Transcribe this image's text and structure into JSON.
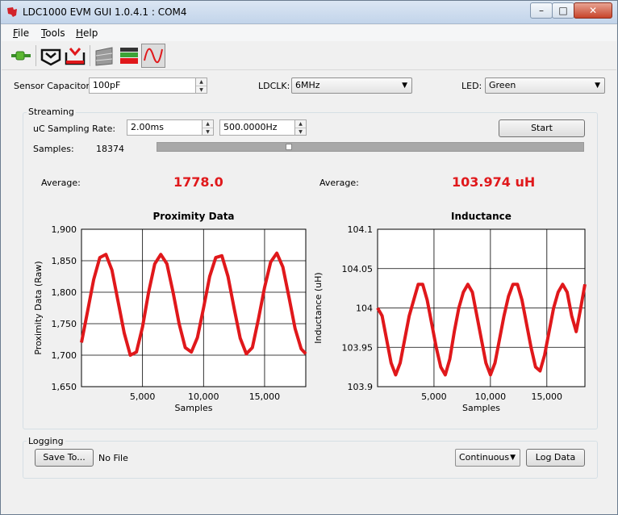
{
  "window": {
    "title": "LDC1000 EVM GUI 1.0.4.1 : COM4",
    "min_glyph": "–",
    "max_glyph": "□",
    "close_glyph": "✕"
  },
  "menu": [
    {
      "first": "F",
      "rest": "ile"
    },
    {
      "first": "T",
      "rest": "ools"
    },
    {
      "first": "H",
      "rest": "elp"
    }
  ],
  "toolbar": {
    "icons": [
      "connect-plug-icon",
      "read-register-icon",
      "write-register-icon",
      "config-icon",
      "threshold-icon",
      "graph-icon"
    ],
    "accent": "#e0181b"
  },
  "settings": {
    "sensor_cap_label": "Sensor Capacitor:",
    "sensor_cap_value": "100pF",
    "ldclk_label": "LDCLK:",
    "ldclk_value": "6MHz",
    "led_label": "LED:",
    "led_value": "Green"
  },
  "streaming": {
    "title": "Streaming",
    "rate_label": "uC Sampling Rate:",
    "rate_ms": "2.00ms",
    "rate_hz": "500.0000Hz",
    "start_label": "Start",
    "samples_label": "Samples:",
    "samples_value": "18374",
    "avg_label_1": "Average:",
    "avg_value_1": "1778.0",
    "avg_label_2": "Average:",
    "avg_value_2": "103.974 uH"
  },
  "logging": {
    "title": "Logging",
    "save_label": "Save To...",
    "file_label": "No File",
    "mode_value": "Continuous",
    "log_label": "Log Data"
  },
  "chart_data": [
    {
      "type": "line",
      "title": "Proximity Data",
      "xlabel": "Samples",
      "ylabel": "Proximity Data (Raw)",
      "xlim": [
        0,
        18374
      ],
      "ylim": [
        1650,
        1900
      ],
      "xticks": [
        5000,
        10000,
        15000
      ],
      "xtick_labels": [
        "5,000",
        "10,000",
        "15,000"
      ],
      "yticks": [
        1650,
        1700,
        1750,
        1800,
        1850,
        1900
      ],
      "ytick_labels": [
        "1,650",
        "1,700",
        "1,750",
        "1,800",
        "1,850",
        "1,900"
      ],
      "grid": true,
      "color": "#e0181b",
      "series": [
        {
          "x": [
            0,
            500,
            1000,
            1500,
            2000,
            2500,
            3000,
            3500,
            4000,
            4500,
            5000,
            5500,
            6000,
            6500,
            7000,
            7500,
            8000,
            8500,
            9000,
            9500,
            10000,
            10500,
            11000,
            11500,
            12000,
            12500,
            13000,
            13500,
            14000,
            14500,
            15000,
            15500,
            16000,
            16500,
            17000,
            17500,
            18000,
            18374
          ],
          "y": [
            1720,
            1770,
            1820,
            1855,
            1860,
            1835,
            1785,
            1735,
            1700,
            1705,
            1745,
            1800,
            1845,
            1860,
            1845,
            1800,
            1750,
            1712,
            1705,
            1728,
            1775,
            1825,
            1855,
            1858,
            1825,
            1775,
            1727,
            1702,
            1712,
            1758,
            1808,
            1848,
            1862,
            1840,
            1792,
            1742,
            1710,
            1702
          ]
        }
      ]
    },
    {
      "type": "line",
      "title": "Inductance",
      "xlabel": "Samples",
      "ylabel": "Inductance (uH)",
      "xlim": [
        0,
        18374
      ],
      "ylim": [
        103.9,
        104.1
      ],
      "xticks": [
        5000,
        10000,
        15000
      ],
      "xtick_labels": [
        "5,000",
        "10,000",
        "15,000"
      ],
      "yticks": [
        103.9,
        103.95,
        104,
        104.05,
        104.1
      ],
      "ytick_labels": [
        "103.9",
        "103.95",
        "104",
        "104.05",
        "104.1"
      ],
      "grid": true,
      "color": "#e0181b",
      "series": [
        {
          "x": [
            0,
            400,
            800,
            1200,
            1600,
            2000,
            2400,
            2800,
            3200,
            3600,
            4000,
            4400,
            4800,
            5200,
            5600,
            6000,
            6400,
            6800,
            7200,
            7600,
            8000,
            8400,
            8800,
            9200,
            9600,
            10000,
            10400,
            10800,
            11200,
            11600,
            12000,
            12400,
            12800,
            13200,
            13600,
            14000,
            14400,
            14800,
            15200,
            15600,
            16000,
            16400,
            16800,
            17200,
            17600,
            18000,
            18374
          ],
          "y": [
            104,
            103.99,
            103.96,
            103.93,
            103.915,
            103.93,
            103.96,
            103.99,
            104.01,
            104.03,
            104.03,
            104.01,
            103.98,
            103.95,
            103.925,
            103.915,
            103.935,
            103.97,
            104,
            104.02,
            104.03,
            104.02,
            103.99,
            103.96,
            103.93,
            103.915,
            103.93,
            103.96,
            103.99,
            104.015,
            104.03,
            104.03,
            104.01,
            103.98,
            103.95,
            103.925,
            103.92,
            103.94,
            103.97,
            104,
            104.02,
            104.03,
            104.02,
            103.99,
            103.97,
            104,
            104.03
          ]
        }
      ]
    }
  ]
}
